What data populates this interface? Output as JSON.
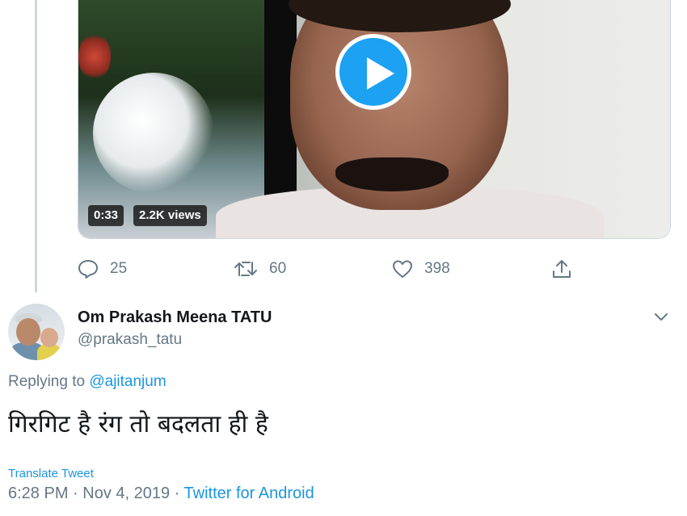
{
  "video": {
    "duration": "0:33",
    "views": "2.2K views"
  },
  "actions": {
    "replies": "25",
    "retweets": "60",
    "likes": "398"
  },
  "reply": {
    "display_name": "Om Prakash Meena TATU",
    "handle": "@prakash_tatu",
    "replying_prefix": "Replying to ",
    "replying_to": "@ajitanjum",
    "text": "गिरगिट है रंग तो बदलता ही है",
    "translate_label": "Translate Tweet",
    "time": "6:28 PM",
    "separator": " · ",
    "date": "Nov 4, 2019",
    "source": "Twitter for Android"
  },
  "colors": {
    "accent": "#1da1f2",
    "link": "#1b95e0",
    "muted": "#657786"
  },
  "icons": {
    "play": "play-icon",
    "reply": "reply-icon",
    "retweet": "retweet-icon",
    "like": "heart-icon",
    "share": "share-icon",
    "menu": "chevron-down-icon"
  }
}
